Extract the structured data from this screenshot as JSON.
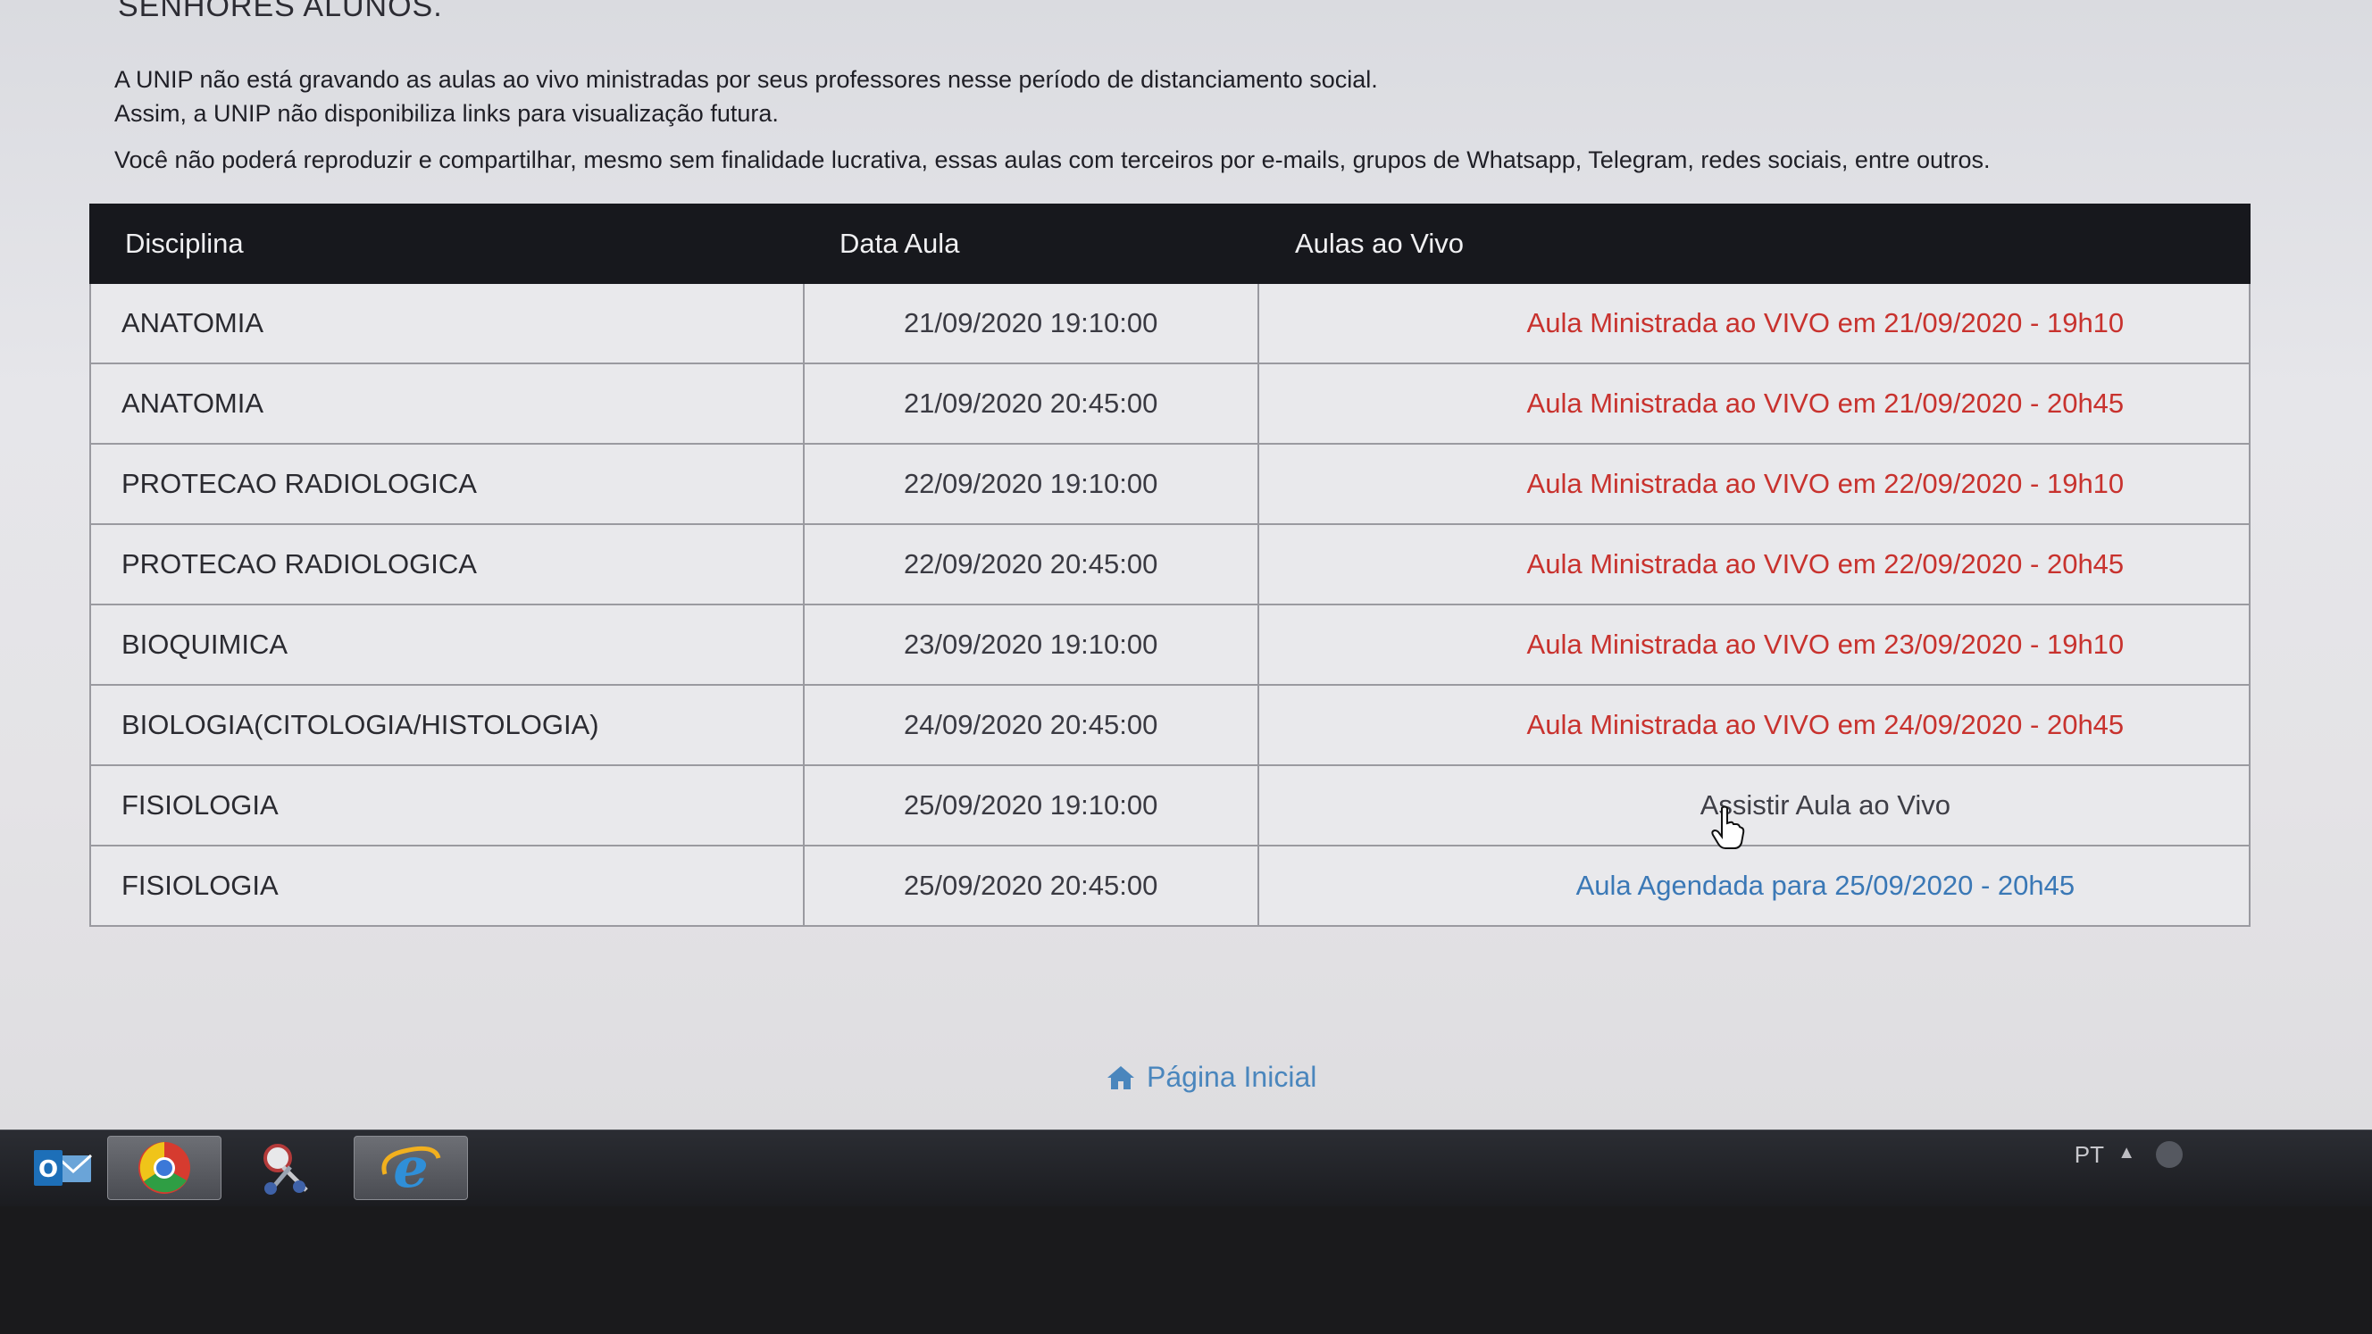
{
  "page": {
    "heading": "SENHORES ALUNOS.",
    "notice": [
      "A UNIP não está gravando as aulas ao vivo ministradas por seus professores nesse período de distanciamento social.",
      "Assim, a UNIP não disponibiliza links para visualização futura.",
      "Você não poderá reproduzir e compartilhar, mesmo sem finalidade lucrativa, essas aulas com terceiros por e-mails, grupos de Whatsapp, Telegram, redes sociais, entre outros."
    ]
  },
  "table": {
    "headers": {
      "discipline": "Disciplina",
      "date": "Data Aula",
      "live": "Aulas ao Vivo"
    },
    "rows": [
      {
        "discipline": "ANATOMIA",
        "date": "21/09/2020 19:10:00",
        "live": "Aula Ministrada ao VIVO em 21/09/2020 - 19h10"
      },
      {
        "discipline": "ANATOMIA",
        "date": "21/09/2020 20:45:00",
        "live": "Aula Ministrada ao VIVO em 21/09/2020 - 20h45"
      },
      {
        "discipline": "PROTECAO RADIOLOGICA",
        "date": "22/09/2020 19:10:00",
        "live": "Aula Ministrada ao VIVO em 22/09/2020 - 19h10"
      },
      {
        "discipline": "PROTECAO RADIOLOGICA",
        "date": "22/09/2020 20:45:00",
        "live": "Aula Ministrada ao VIVO em 22/09/2020 - 20h45"
      },
      {
        "discipline": "BIOQUIMICA",
        "date": "23/09/2020 19:10:00",
        "live": "Aula Ministrada ao VIVO em 23/09/2020 - 19h10"
      },
      {
        "discipline": "BIOLOGIA(CITOLOGIA/HISTOLOGIA)",
        "date": "24/09/2020 20:45:00",
        "live": "Aula Ministrada ao VIVO em 24/09/2020 - 20h45"
      },
      {
        "discipline": "FISIOLOGIA",
        "date": "25/09/2020 19:10:00",
        "live": "Assistir Aula ao Vivo"
      },
      {
        "discipline": "FISIOLOGIA",
        "date": "25/09/2020 20:45:00",
        "live": "Aula Agendada para 25/09/2020 - 20h45"
      }
    ]
  },
  "footer": {
    "home_link": "Página Inicial",
    "home_icon": "home-icon"
  },
  "taskbar": {
    "apps": [
      "outlook-icon",
      "chrome-icon",
      "snipping-tool-icon",
      "internet-explorer-icon"
    ],
    "tray_language": "PT"
  },
  "colors": {
    "header_bg": "#17181d",
    "done_text": "#c8322e",
    "scheduled_text": "#3a78b6",
    "link_text": "#4a86bd"
  }
}
